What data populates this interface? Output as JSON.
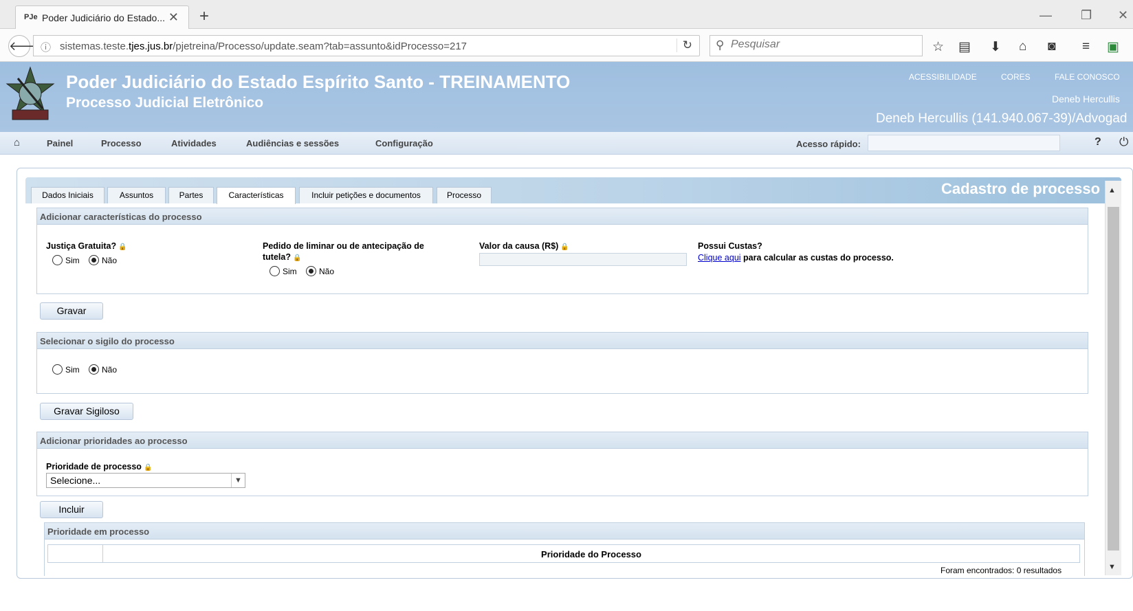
{
  "browser": {
    "tab_favicon": "PJe",
    "tab_title": "Poder Judiciário do Estado...",
    "url_prefix": "sistemas.teste.",
    "url_domain": "tjes.jus.br",
    "url_path": "/pjetreina/Processo/update.seam?tab=assunto&idProcesso=217",
    "search_placeholder": "Pesquisar"
  },
  "header": {
    "title": "Poder Judiciário do Estado Espírito Santo - TREINAMENTO",
    "subtitle": "Processo Judicial Eletrônico",
    "links": [
      "ACESSIBILIDADE",
      "CORES",
      "FALE CONOSCO"
    ],
    "user_short": "Deneb Hercullis",
    "user_full": "Deneb Hercullis (141.940.067-39)/Advogad"
  },
  "menu": {
    "items": [
      "Painel",
      "Processo",
      "Atividades",
      "Audiências e sessões",
      "Configuração"
    ],
    "quick_access_label": "Acesso rápido:"
  },
  "panel": {
    "title": "Cadastro de processo",
    "tabs": [
      "Dados Iniciais",
      "Assuntos",
      "Partes",
      "Características",
      "Incluir petições e documentos",
      "Processo"
    ],
    "active_tab": "Características"
  },
  "caracteristicas": {
    "heading": "Adicionar características do processo",
    "justica_label": "Justiça Gratuita?",
    "liminar_label_1": "Pedido de liminar ou de antecipação de",
    "liminar_label_2": "tutela?",
    "valor_label": "Valor da causa (R$)",
    "valor_value": "",
    "custas_label": "Possui Custas?",
    "custas_link": "Clique aqui",
    "custas_text": "para calcular as custas do processo.",
    "sim": "Sim",
    "nao": "Não",
    "save_button": "Gravar"
  },
  "sigilo": {
    "heading": "Selecionar o sigilo do processo",
    "sim": "Sim",
    "nao": "Não",
    "save_button": "Gravar Sigiloso"
  },
  "prioridades": {
    "heading": "Adicionar prioridades ao processo",
    "field_label": "Prioridade de processo",
    "select_value": "Selecione...",
    "add_button": "Incluir",
    "table_heading": "Prioridade em processo",
    "column_header": "Prioridade do Processo",
    "results_text": "Foram encontrados: 0 resultados"
  }
}
